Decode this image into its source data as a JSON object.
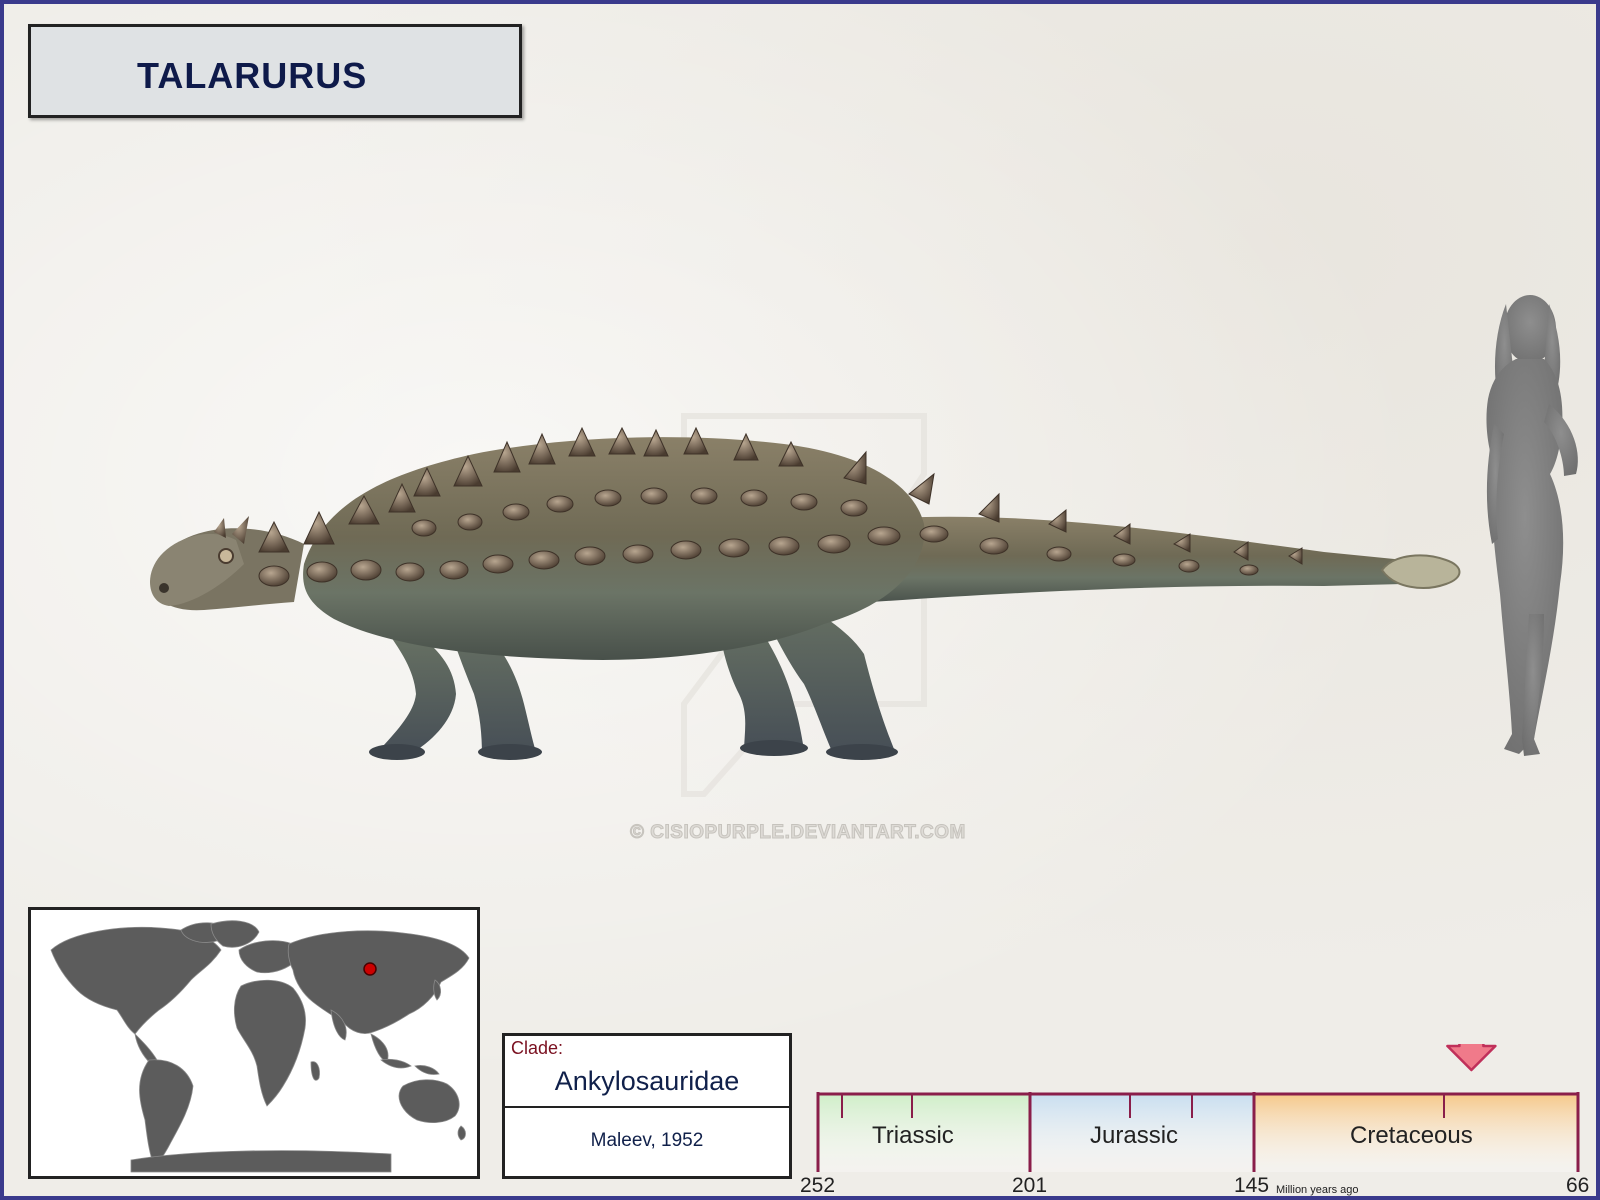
{
  "title": "TALARURUS",
  "watermark": "© CISIOPURPLE.DEVIANTART.COM",
  "clade": {
    "label": "Clade:",
    "name": "Ankylosauridae",
    "author": "Maleev, 1952"
  },
  "timeline": {
    "periods": [
      "Triassic",
      "Jurassic",
      "Cretaceous"
    ],
    "ticks": [
      "252",
      "201",
      "145",
      "66"
    ],
    "unit": "Million years ago",
    "marker_ma": 92
  },
  "icons": [
    "world-map",
    "location-dot-icon",
    "dinosaur-illustration",
    "human-silhouette",
    "arrow-down-icon"
  ],
  "colors": {
    "border": "#3a3a8c",
    "title_text": "#0e1a4a",
    "clade_label": "#7a1020",
    "timeline_axis": "#8a1e4a",
    "triassic": "#cfeec8",
    "jurassic": "#c8def0",
    "cretaceous": "#f6c88a",
    "marker": "#f07a8a",
    "location_dot": "#cc0000"
  }
}
